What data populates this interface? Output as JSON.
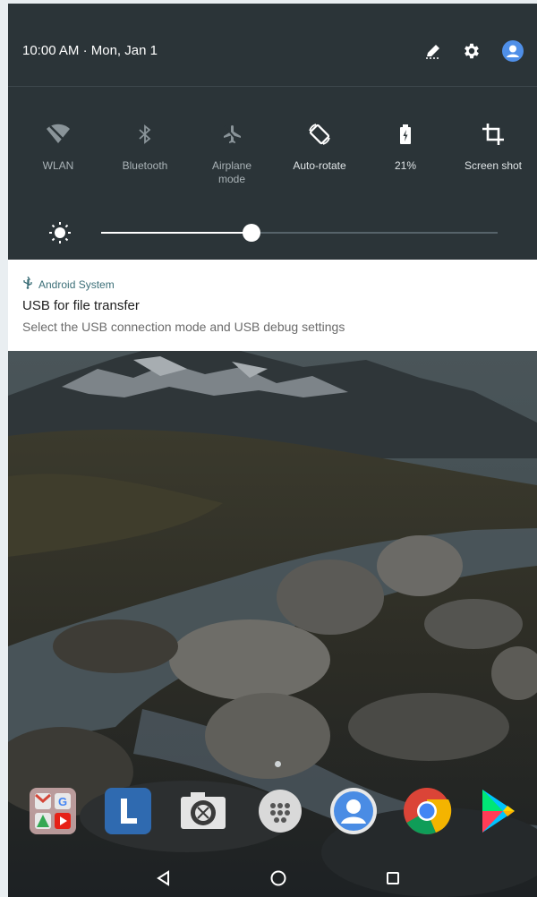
{
  "status_bar": {
    "time": "10:00 AM",
    "separator": "·",
    "date": "Mon, Jan 1"
  },
  "header_icons": [
    "edit-icon",
    "gear-icon",
    "account-icon"
  ],
  "quick_tiles": [
    {
      "label": "WLAN",
      "icon": "wifi-off-icon",
      "active": false
    },
    {
      "label": "Bluetooth",
      "icon": "bluetooth-icon",
      "active": false
    },
    {
      "label": "Airplane\nmode",
      "icon": "airplane-icon",
      "active": false
    },
    {
      "label": "Auto-rotate",
      "icon": "auto-rotate-icon",
      "active": true
    },
    {
      "label": "21%",
      "icon": "battery-icon",
      "active": true
    },
    {
      "label": "Screen shot",
      "icon": "crop-icon",
      "active": true
    }
  ],
  "brightness": {
    "level": 0.38,
    "icon": "brightness-icon"
  },
  "notification": {
    "app_name": "Android System",
    "icon": "usb-icon",
    "title": "USB for file transfer",
    "text": "Select the USB connection mode and USB debug settings"
  },
  "dock_apps": [
    "google-apps-folder",
    "lenovo-launcher-app",
    "camera-app",
    "app-drawer",
    "contacts-app",
    "chrome-app",
    "play-store-app"
  ],
  "nav_buttons": [
    "back-icon",
    "home-icon",
    "recents-icon"
  ],
  "colors": {
    "panel": "#2b3438",
    "notification_bg": "#ffffff",
    "accent": "#3b6e77"
  }
}
